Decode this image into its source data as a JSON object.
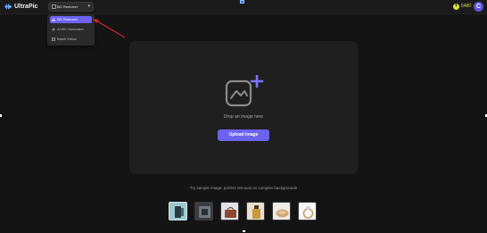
{
  "header": {
    "brand": "UltraPic",
    "tool_select": {
      "label": "BG Remover",
      "chevron": "▾"
    },
    "credits": {
      "coin_glyph": "+",
      "amount": "5480"
    },
    "avatar_letter": "C"
  },
  "dropdown": {
    "items": [
      {
        "label": "BG Remover",
        "icon": "scissors-icon",
        "active": true
      },
      {
        "label": "AI BG Generator",
        "icon": "sparkle-icon",
        "active": false
      },
      {
        "label": "Batch Editor",
        "icon": "layers-icon",
        "active": false
      }
    ]
  },
  "upload_card": {
    "drop_text": "Drop an image here",
    "button_label": "Upload Image"
  },
  "samples": {
    "caption": "Try sample image, perfect removal on complex backgrounds",
    "items": [
      {
        "name": "sample-phone",
        "bg": "#9ec8d1",
        "accent": "#2a3b3d"
      },
      {
        "name": "sample-device",
        "bg": "#3a3d40",
        "accent": "#6f777b"
      },
      {
        "name": "sample-bag",
        "bg": "#dfe3e6",
        "accent": "#8a4a2f"
      },
      {
        "name": "sample-perfume",
        "bg": "#e9ded0",
        "accent": "#c89a3a"
      },
      {
        "name": "sample-bread",
        "bg": "#f0ece6",
        "accent": "#d1a878"
      },
      {
        "name": "sample-ring",
        "bg": "#f7f7f7",
        "accent": "#c9a06b"
      }
    ]
  },
  "colors": {
    "accent": "#6b63ee",
    "credit": "#d9e53b",
    "annotation_arrow": "#d62828"
  }
}
